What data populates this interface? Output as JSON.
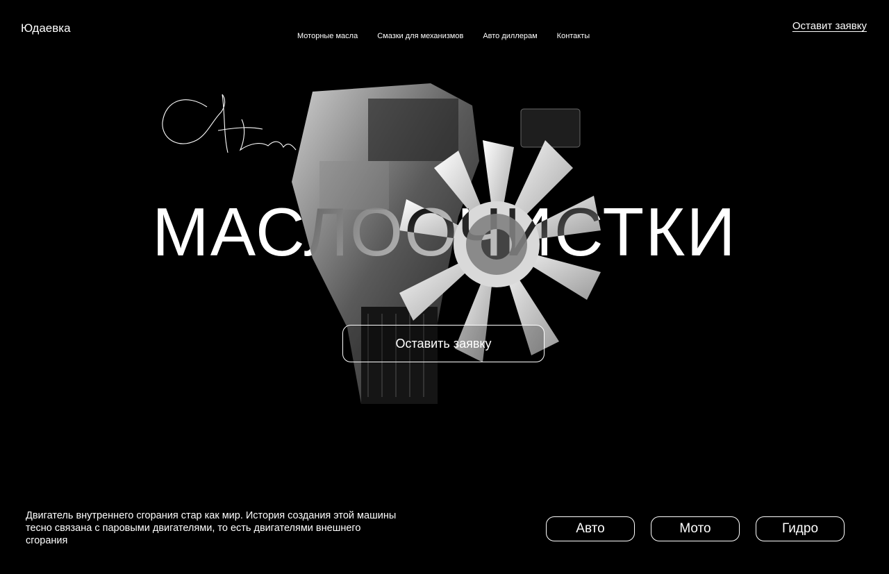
{
  "header": {
    "logo": "Юдаевка",
    "nav": [
      "Моторные масла",
      "Смазки для механизмов",
      "Авто диллерам",
      "Контакты"
    ],
    "cta": "Оставит заявку"
  },
  "hero": {
    "headline": "МАСЛООЧИСТКИ",
    "cta": "Оставить заявку",
    "image": "engine-image",
    "signature": "handwritten-signature"
  },
  "footer": {
    "description": "Двигатель внутреннего сгорания стар как мир. История создания этой машины тесно связана с паровыми двигателями, то есть двигателями внешнего сгорания",
    "categories": [
      "Авто",
      "Мото",
      "Гидро"
    ]
  },
  "colors": {
    "background": "#000000",
    "text": "#ffffff"
  }
}
